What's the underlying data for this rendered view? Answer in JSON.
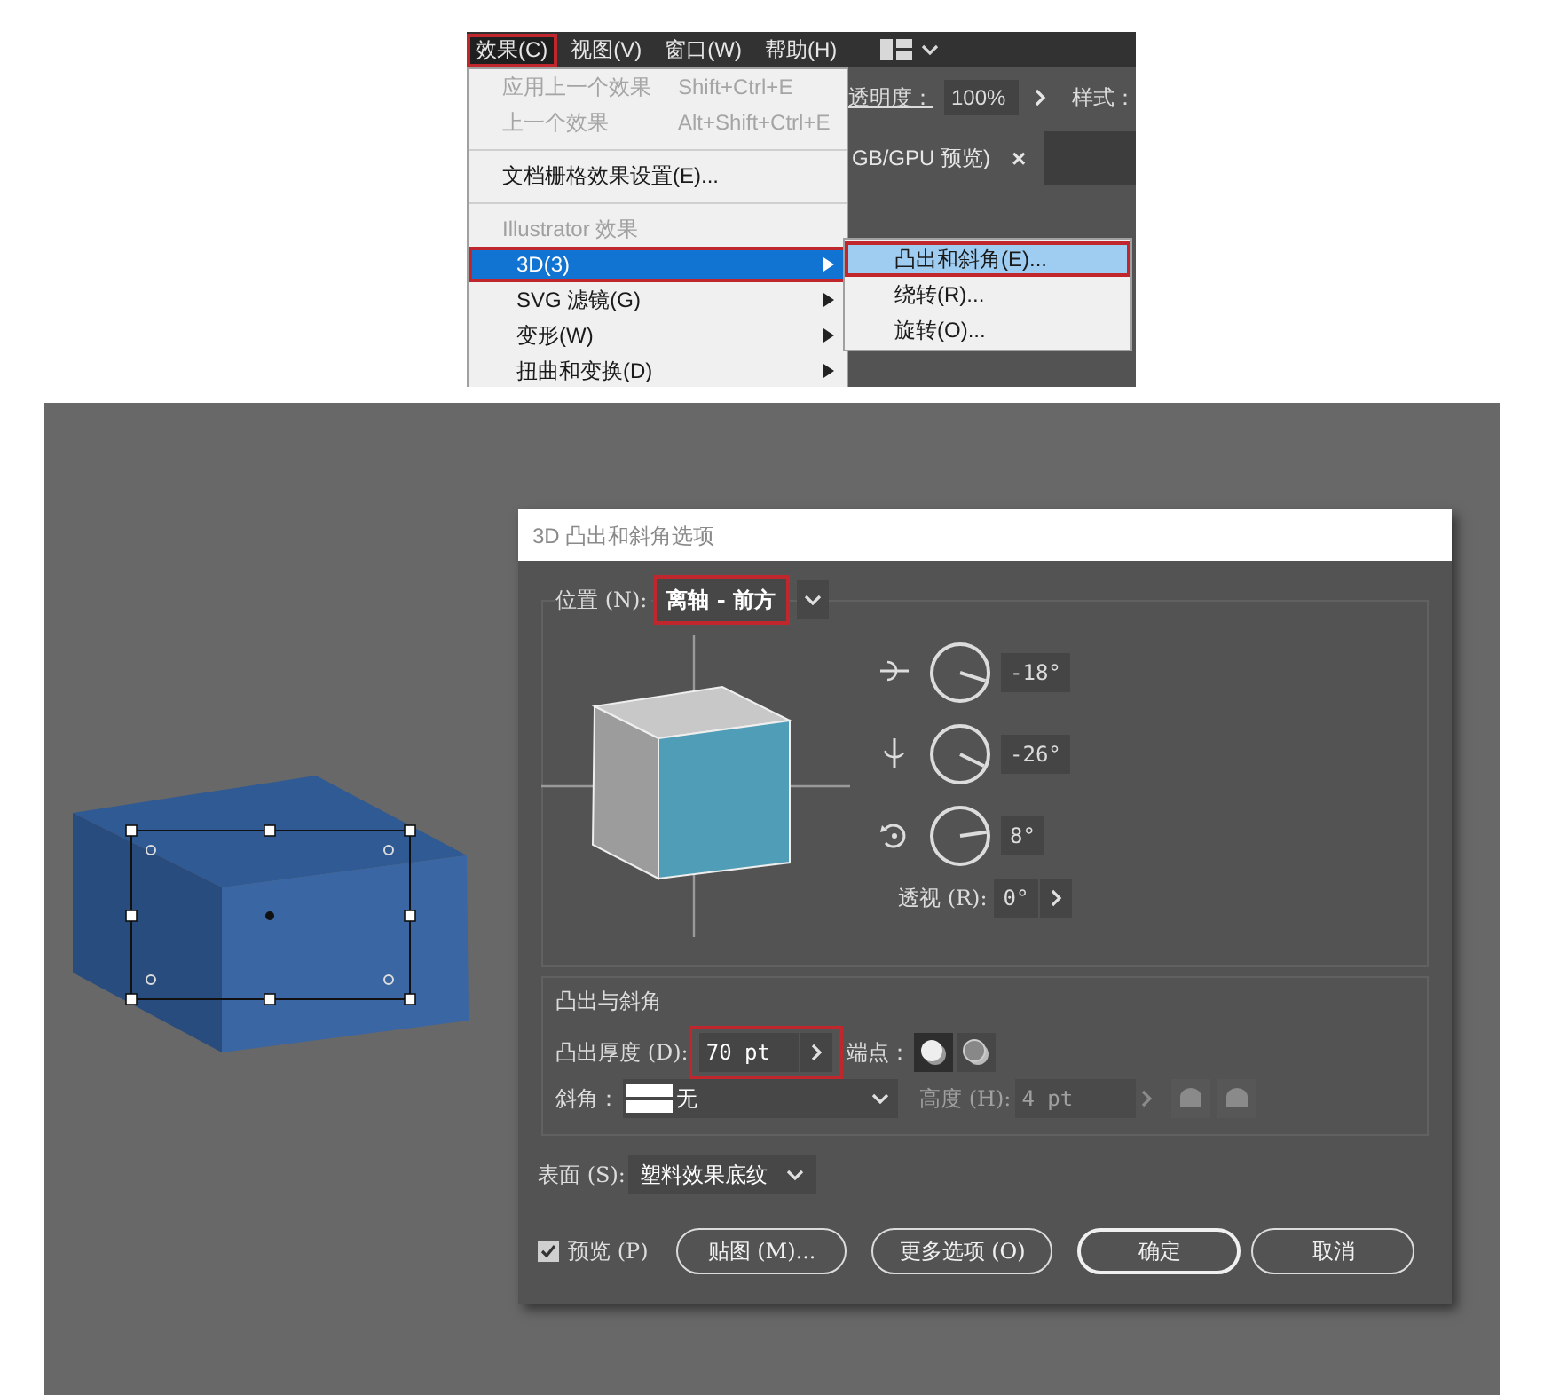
{
  "menu_screenshot": {
    "menubar": [
      {
        "label": "效果(C)",
        "selected": true,
        "highlighted": true
      },
      {
        "label": "视图(V)",
        "selected": false,
        "highlighted": false
      },
      {
        "label": "窗口(W)",
        "selected": false,
        "highlighted": false
      },
      {
        "label": "帮助(H)",
        "selected": false,
        "highlighted": false
      }
    ],
    "menu_items": [
      {
        "kind": "item",
        "label": "应用上一个效果",
        "shortcut": "Shift+Ctrl+E",
        "disabled": true,
        "submenu": false,
        "selected": false,
        "highlighted": false
      },
      {
        "kind": "item",
        "label": "上一个效果",
        "shortcut": "Alt+Shift+Ctrl+E",
        "disabled": true,
        "submenu": false,
        "selected": false,
        "highlighted": false
      },
      {
        "kind": "separator"
      },
      {
        "kind": "item",
        "label": "文档栅格效果设置(E)...",
        "disabled": false,
        "submenu": false,
        "selected": false,
        "highlighted": false
      },
      {
        "kind": "separator"
      },
      {
        "kind": "header",
        "label": "Illustrator 效果"
      },
      {
        "kind": "item",
        "label": "3D(3)",
        "disabled": false,
        "submenu": true,
        "selected": true,
        "highlighted": true
      },
      {
        "kind": "item",
        "label": "SVG 滤镜(G)",
        "disabled": false,
        "submenu": true,
        "selected": false,
        "highlighted": false
      },
      {
        "kind": "item",
        "label": "变形(W)",
        "disabled": false,
        "submenu": true,
        "selected": false,
        "highlighted": false
      },
      {
        "kind": "item",
        "label": "扭曲和变换(D)",
        "disabled": false,
        "submenu": true,
        "selected": false,
        "highlighted": false
      }
    ],
    "submenu": [
      {
        "label": "凸出和斜角(E)...",
        "selected": true,
        "highlighted": true
      },
      {
        "label": "绕转(R)...",
        "selected": false,
        "highlighted": false
      },
      {
        "label": "旋转(O)...",
        "selected": false,
        "highlighted": false
      }
    ],
    "toolbar": {
      "opacity_label": "透明度：",
      "opacity_value": "100%",
      "style_label": "样式："
    },
    "document_tab": {
      "label": "GB/GPU 预览)",
      "close": "×"
    }
  },
  "dialog": {
    "title": "3D 凸出和斜角选项",
    "position": {
      "label": "位置 (N):",
      "value": "离轴 - 前方",
      "highlighted": true
    },
    "rotations": [
      {
        "kind": "x",
        "value": "-18°"
      },
      {
        "kind": "y",
        "value": "-26°"
      },
      {
        "kind": "z",
        "value": "8°"
      }
    ],
    "perspective": {
      "label": "透视 (R):",
      "value": "0°"
    },
    "extrude": {
      "title": "凸出与斜角",
      "depth_label": "凸出厚度 (D):",
      "depth_value": "70 pt",
      "depth_highlighted": true,
      "cap_label": "端点：",
      "caps": [
        {
          "selected": true
        },
        {
          "selected": false
        }
      ],
      "bevel_label": "斜角：",
      "bevel_value": "无",
      "height_label": "高度 (H):",
      "height_value": "4 pt",
      "height_disabled": true
    },
    "surface": {
      "label": "表面 (S):",
      "value": "塑料效果底纹"
    },
    "preview": {
      "label": "预览 (P)",
      "checked": true
    },
    "buttons": [
      {
        "label": "贴图 (M)...",
        "kind": "normal"
      },
      {
        "label": "更多选项 (O)",
        "kind": "normal"
      },
      {
        "label": "确定",
        "kind": "default"
      },
      {
        "label": "取消",
        "kind": "normal"
      }
    ]
  }
}
